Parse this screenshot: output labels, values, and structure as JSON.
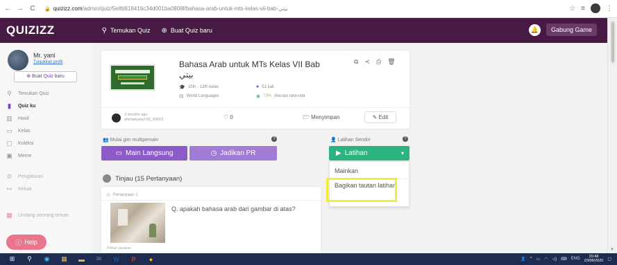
{
  "browser": {
    "back": "←",
    "forward": "→",
    "reload": "C",
    "domain": "quizizz.com",
    "path": "/admin/quiz/5e8b618416c34d001ba0808f/bahasa-arab-untuk-mts-kelas-vii-bab-بيتي",
    "star": "☆"
  },
  "header": {
    "logo": "QUIZIZZ",
    "nav": [
      {
        "label": "Temukan Quiz",
        "icon": "search-icon"
      },
      {
        "label": "Buat Quiz baru",
        "icon": "plus-circle-icon"
      }
    ],
    "join_label": "Gabung Game"
  },
  "sidebar": {
    "user_name": "Mr. yani",
    "user_link": "Tunjukkan profil",
    "make_quiz": "Buat Quiz baru",
    "items": [
      {
        "label": "Temukan Quiz",
        "icon": "search-icon"
      },
      {
        "label": "Quiz ku",
        "icon": "document-icon"
      },
      {
        "label": "Hasil",
        "icon": "bar-chart-icon"
      },
      {
        "label": "Kelas",
        "icon": "classroom-icon"
      },
      {
        "label": "Koleksi",
        "icon": "folder-icon"
      },
      {
        "label": "Meme",
        "icon": "image-icon"
      },
      {
        "label": "Pengaturan",
        "icon": "gear-icon"
      },
      {
        "label": "Keluar",
        "icon": "logout-icon"
      },
      {
        "label": "Undang seorang teman",
        "icon": "gift-icon"
      }
    ],
    "help": "Help"
  },
  "quiz": {
    "title": "Bahasa Arab untuk MTs Kelas VII Bab بيتي",
    "grade": "10th - 12th kelas",
    "subject": "World Languages",
    "plays": "51 kali",
    "accuracy_value": "73%",
    "accuracy_label": "Akurasi rata-rata",
    "created": "3 months ago",
    "creator": "ahmadyany100_93653",
    "likes": "0",
    "save": "Menyimpan",
    "edit": "Edit"
  },
  "play": {
    "multiplayer_label": "Mulai gim multipemain",
    "live": "Main Langsung",
    "homework": "Jadikan PR",
    "self_label": "Latihan Sendiri",
    "practice": "Latihan",
    "dropdown": [
      "Mainkan",
      "Bagikan tautan latihan"
    ]
  },
  "review": {
    "title": "Tinjau (15 Pertanyaan)",
    "question_number": "Pertanyaan 1",
    "question_text": "Q. apakah bahasa arab dari gambar di atas?",
    "footer": "Pilihan jawaban"
  },
  "taskbar": {
    "lang": "ENG",
    "time": "20:48",
    "date": "23/06/2020"
  },
  "colors": {
    "header": "#461a42",
    "live": "#8c5bc9",
    "homework": "#a27bd4",
    "practice": "#2cb37f",
    "highlight": "#f3ea3a",
    "help": "#e9768d"
  }
}
